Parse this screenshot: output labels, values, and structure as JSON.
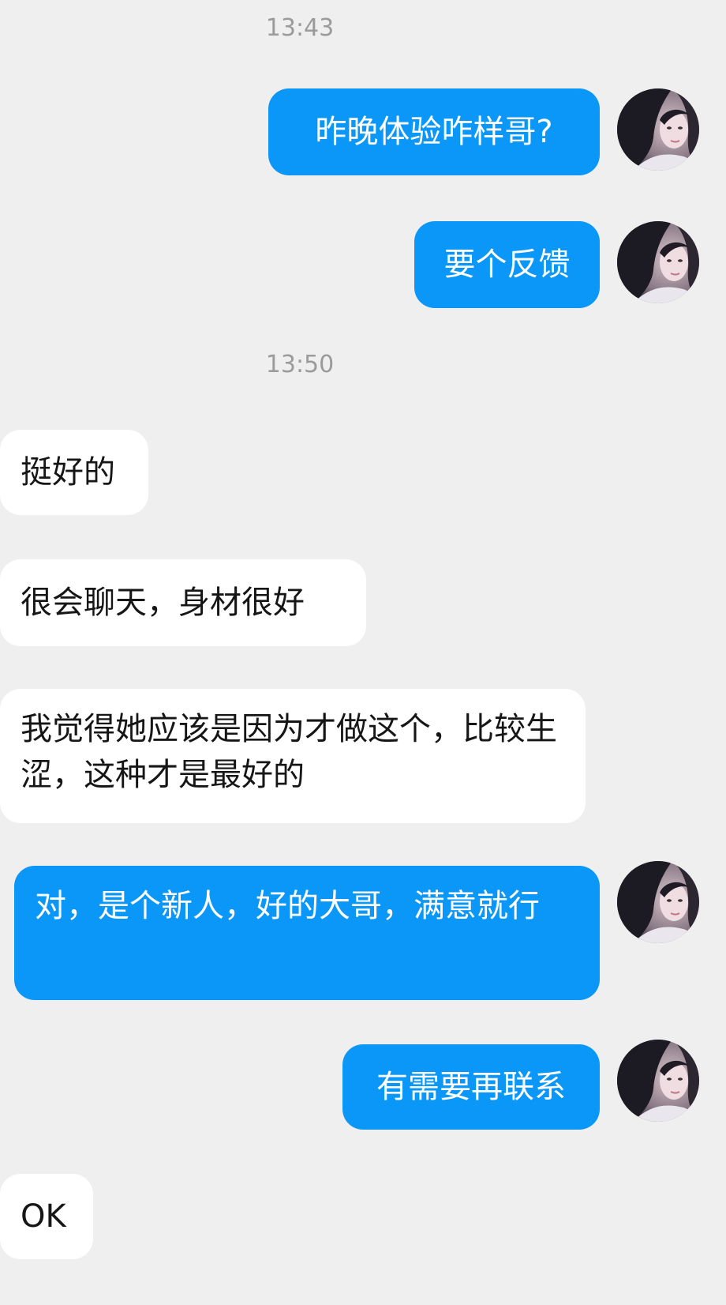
{
  "timestamps": [
    "13:43",
    "13:50"
  ],
  "messages": [
    {
      "side": "out",
      "text": "昨晚体验咋样哥?"
    },
    {
      "side": "out",
      "text": "要个反馈"
    },
    {
      "side": "in",
      "text": "挺好的"
    },
    {
      "side": "in",
      "text": "很会聊天，身材很好"
    },
    {
      "side": "in",
      "text": "我觉得她应该是因为才做这个，比较生涩，这种才是最好的"
    },
    {
      "side": "out",
      "text": "对，是个新人，好的大哥，满意就行"
    },
    {
      "side": "out",
      "text": "有需要再联系"
    },
    {
      "side": "in",
      "text": "OK"
    }
  ],
  "colors": {
    "background": "#efefef",
    "outgoing_bubble": "#0a97f7",
    "incoming_bubble": "#ffffff",
    "timestamp": "#9b9b9b"
  },
  "avatar": {
    "icon": "user-avatar-photo"
  }
}
